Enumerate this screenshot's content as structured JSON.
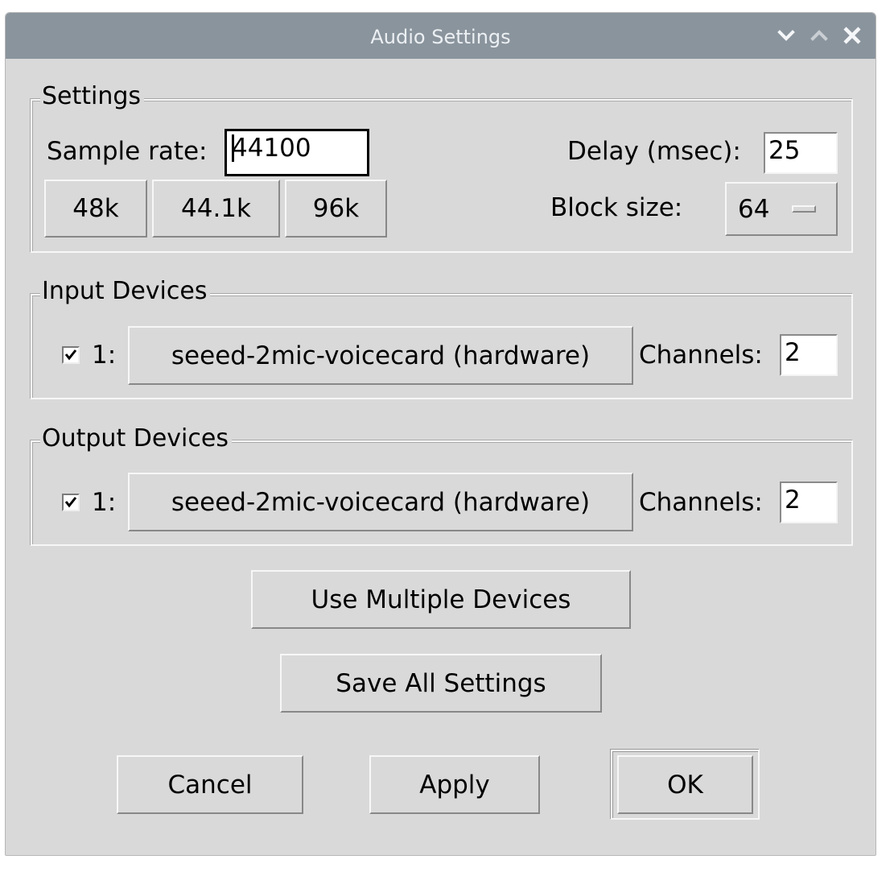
{
  "window": {
    "title": "Audio Settings"
  },
  "settings": {
    "legend": "Settings",
    "sample_rate_label": "Sample rate:",
    "sample_rate_value": "44100",
    "delay_label": "Delay (msec):",
    "delay_value": "25",
    "block_size_label": "Block size:",
    "block_size_value": "64",
    "rate_buttons": [
      "48k",
      "44.1k",
      "96k"
    ]
  },
  "input_devices": {
    "legend": "Input Devices",
    "checked": true,
    "index_label": "1:",
    "device_name": "seeed-2mic-voicecard (hardware)",
    "channels_label": "Channels:",
    "channels_value": "2"
  },
  "output_devices": {
    "legend": "Output Devices",
    "checked": true,
    "index_label": "1:",
    "device_name": "seeed-2mic-voicecard (hardware)",
    "channels_label": "Channels:",
    "channels_value": "2"
  },
  "actions": {
    "use_multiple": "Use Multiple Devices",
    "save_all": "Save All Settings",
    "cancel": "Cancel",
    "apply": "Apply",
    "ok": "OK"
  },
  "colors": {
    "titlebar": "#8a949d",
    "window_bg": "#d9d9d9",
    "entry_bg": "#ffffff"
  },
  "icons": {
    "minimize": "chevron-down-icon",
    "maximize": "chevron-up-icon",
    "close": "close-icon",
    "checkbox": "checkmark-icon"
  }
}
